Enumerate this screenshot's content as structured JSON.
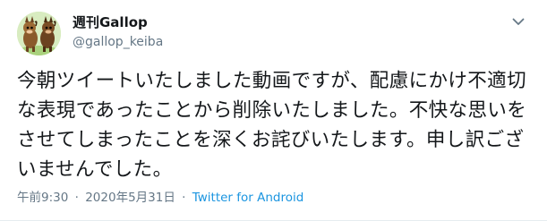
{
  "tweet": {
    "display_name": "週刊Gallop",
    "handle": "@gallop_keiba",
    "text": "今朝ツイートいたしました動画ですが、配慮にかけ不適切な表現であったことから削除いたしました。不快な思いをさせてしまったことを深くお詫びいたします。申し訳ございませんでした。",
    "time": "午前9:30",
    "separator": "·",
    "date": "2020年5月31日",
    "source": "Twitter for Android"
  },
  "icons": {
    "avatar": "horse-mascots-avatar",
    "menu": "chevron-down-icon"
  },
  "colors": {
    "text": "#14171a",
    "secondary": "#657786",
    "link": "#1b95e0"
  }
}
